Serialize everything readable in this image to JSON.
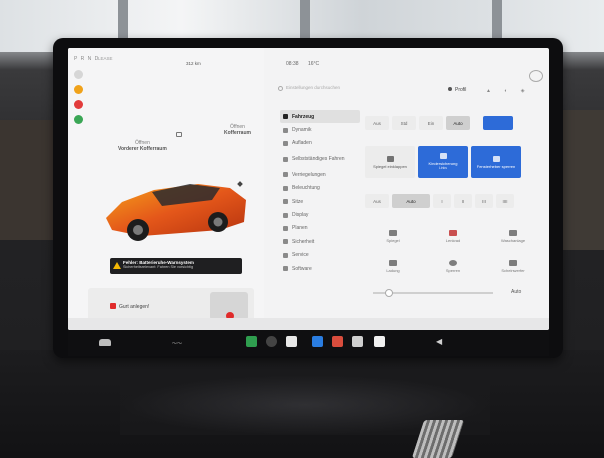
{
  "status": {
    "prnd": "P R N D",
    "speed_unit": "LEASE",
    "range": "312 km",
    "time": "08:38",
    "temp": "16°C"
  },
  "search": {
    "placeholder": "Einstellungen durchsuchen"
  },
  "profile": {
    "label": "Profil"
  },
  "car_view": {
    "frunk": {
      "state": "Öffnen",
      "name": "Vorderer Kofferraum"
    },
    "trunk": {
      "state": "Öffnen",
      "name": "Kofferraum"
    }
  },
  "warning": {
    "title": "Fehler: Batterieruhe-Warnsystem",
    "subtitle": "Sicherheitsrelevant: Fahren Sie vorsichtig",
    "color": "#f2b705"
  },
  "door_alert": {
    "text": "Gurt anlegen!",
    "color": "#e02b2b"
  },
  "menu": [
    {
      "label": "Fahrzeug",
      "icon": "car-icon",
      "active": true
    },
    {
      "label": "Dynamik",
      "icon": "dynamics-icon",
      "active": false
    },
    {
      "label": "Aufladen",
      "icon": "charging-icon",
      "active": false
    },
    {
      "label": "Selbstständiges Fahren",
      "icon": "steering-icon",
      "active": false
    },
    {
      "label": "Verriegelungen",
      "icon": "lock-icon",
      "active": false
    },
    {
      "label": "Beleuchtung",
      "icon": "light-icon",
      "active": false
    },
    {
      "label": "Sitze",
      "icon": "seat-icon",
      "active": false
    },
    {
      "label": "Display",
      "icon": "display-icon",
      "active": false
    },
    {
      "label": "Planen",
      "icon": "plan-icon",
      "active": false
    },
    {
      "label": "Sicherheit",
      "icon": "shield-icon",
      "active": false
    },
    {
      "label": "Service",
      "icon": "wrench-icon",
      "active": false
    },
    {
      "label": "Software",
      "icon": "download-icon",
      "active": false
    }
  ],
  "lights_row": [
    {
      "label": "Aus",
      "selected": false
    },
    {
      "label": "Std",
      "selected": false
    },
    {
      "label": "Ein",
      "selected": false
    },
    {
      "label": "Auto",
      "selected": true
    }
  ],
  "tiles": [
    {
      "label": "Spiegel einklappen",
      "sub": "",
      "active": false
    },
    {
      "label": "Kindersicherung",
      "sub": "Links",
      "active": true
    },
    {
      "label": "Fensterheber sperren",
      "sub": "",
      "active": true
    }
  ],
  "wiper_row": [
    {
      "label": "Aus",
      "selected": false
    },
    {
      "label": "Auto",
      "selected": true
    },
    {
      "label": "I",
      "selected": false
    },
    {
      "label": "II",
      "selected": false
    },
    {
      "label": "III",
      "selected": false
    },
    {
      "label": "IIII",
      "selected": false
    }
  ],
  "features": [
    {
      "label": "Spiegel",
      "icon": "mirror-icon"
    },
    {
      "label": "Lenkrad",
      "icon": "steering-wheel-icon"
    },
    {
      "label": "Waschanlage",
      "icon": "car-wash-icon"
    },
    {
      "label": "Ladung",
      "icon": "charge-port-icon"
    },
    {
      "label": "Sperren",
      "icon": "lock-icon"
    },
    {
      "label": "Scheinwerfer",
      "icon": "headlight-icon"
    }
  ],
  "slider": {
    "auto_label": "Auto",
    "value": 0.1
  },
  "colors": {
    "accent": "#2d6bd8"
  }
}
